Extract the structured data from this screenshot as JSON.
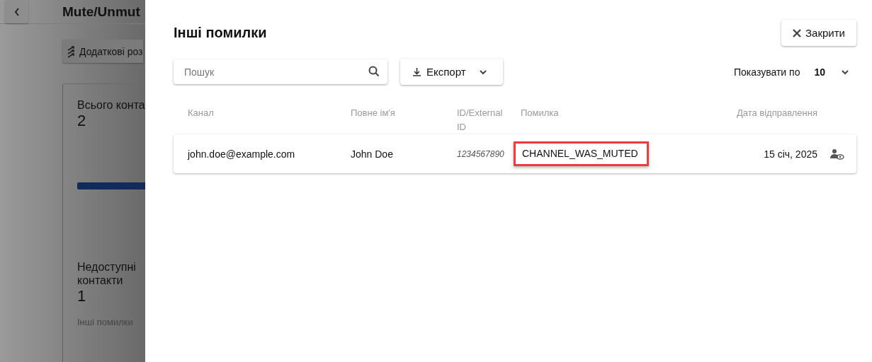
{
  "background_page": {
    "title": "Mute/Unmut",
    "extra_button": "Додаткові роз",
    "stats_card": {
      "total_label": "Всього конта",
      "total_value": "2",
      "unavailable_label": "Недоступні контакти",
      "unavailable_value": "1",
      "other_errors_link": "Інші помилки"
    }
  },
  "drawer": {
    "title": "Інші помилки",
    "close_button": "Закрити",
    "search": {
      "placeholder": "Пошук"
    },
    "export_button": "Експорт",
    "page_size": {
      "label": "Показувати по",
      "value": "10"
    },
    "table": {
      "columns": [
        "Канал",
        "Повне ім'я",
        "ID/External ID",
        "Помилка",
        "Дата відправлення"
      ],
      "rows": [
        {
          "channel": "john.doe@example.com",
          "full_name": "John Doe",
          "id": "1234567890",
          "error": "CHANNEL_WAS_MUTED",
          "error_highlighted": true,
          "date": "15 січ, 2025"
        }
      ]
    }
  }
}
